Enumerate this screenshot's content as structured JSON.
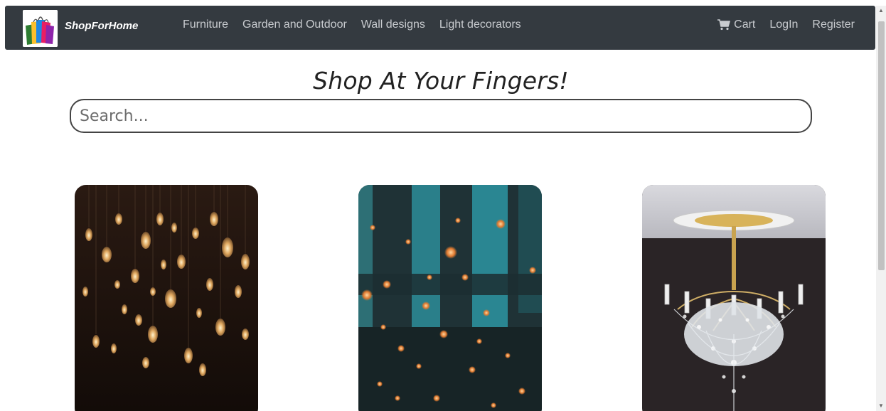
{
  "brand": {
    "name": "ShopForHome"
  },
  "nav": {
    "links": [
      "Furniture",
      "Garden and Outdoor",
      "Wall designs",
      "Light decorators"
    ],
    "cart_label": "Cart",
    "login_label": "LogIn",
    "register_label": "Register"
  },
  "hero": {
    "tagline": "Shop At Your Fingers!"
  },
  "search": {
    "placeholder": "Search..."
  },
  "colors": {
    "navbar": "#343a40",
    "nav_text": "#c8cbcf"
  },
  "products": [
    {
      "image": "hanging-edison-bulbs"
    },
    {
      "image": "bokeh-lights-teal-window"
    },
    {
      "image": "crystal-chandelier"
    }
  ]
}
